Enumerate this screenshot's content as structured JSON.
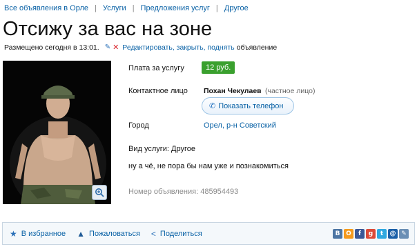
{
  "breadcrumb": [
    "Все объявления в Орле",
    "Услуги",
    "Предложения услуг",
    "Другое"
  ],
  "title": "Отсижу за вас на зоне",
  "meta": {
    "posted": "Размещено сегодня в 13:01.",
    "edit_link": "Редактировать, закрыть, поднять",
    "edit_suffix": "объявление"
  },
  "details": {
    "price_label": "Плата за услугу",
    "price_value": "12 руб.",
    "contact_label": "Контактное лицо",
    "contact_name": "Похан Чекулаев",
    "contact_type": "(частное лицо)",
    "phone_button": "Показать телефон",
    "city_label": "Город",
    "city_value": "Орел, р-н Советский"
  },
  "service": "Вид услуги: Другое",
  "description": "ну а чё, не пора бы нам уже и познакомиться",
  "ad_number": "Номер объявления: 485954493",
  "footer": {
    "favorite": "В избранное",
    "complain": "Пожаловаться",
    "share": "Поделиться"
  },
  "socials": [
    {
      "name": "vkontakte",
      "glyph": "В",
      "color": "#4c75a3"
    },
    {
      "name": "odnoklassniki",
      "glyph": "О",
      "color": "#f59a1e"
    },
    {
      "name": "facebook",
      "glyph": "f",
      "color": "#3b5998"
    },
    {
      "name": "google-plus",
      "glyph": "g",
      "color": "#dd4b39"
    },
    {
      "name": "twitter",
      "glyph": "t",
      "color": "#2fa8e0"
    },
    {
      "name": "mail",
      "glyph": "@",
      "color": "#1a5fa8"
    },
    {
      "name": "livejournal",
      "glyph": "✎",
      "color": "#6b8fb5"
    }
  ],
  "colors": {
    "link": "#0a62a6",
    "price_badge": "#3aa02e"
  }
}
